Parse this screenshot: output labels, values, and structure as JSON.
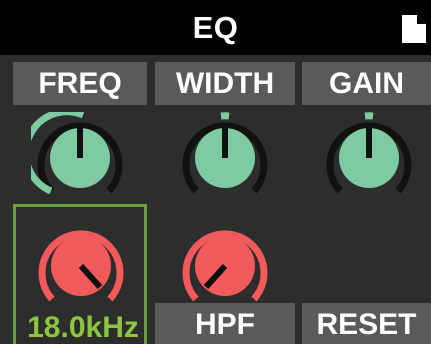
{
  "title": "EQ",
  "headers": {
    "freq": "FREQ",
    "width": "WIDTH",
    "gain": "GAIN"
  },
  "selected_value": "18.0kHz",
  "buttons": {
    "hpf": "HPF",
    "reset": "RESET"
  },
  "colors": {
    "title_bg": "#000000",
    "panel_bg": "#2d2d2d",
    "header_bg": "#5a5a5a",
    "knob_teal": "#7ecba1",
    "knob_red": "#f05a5a",
    "selection": "#8cc63f"
  },
  "icons": {
    "page": "document-icon"
  }
}
